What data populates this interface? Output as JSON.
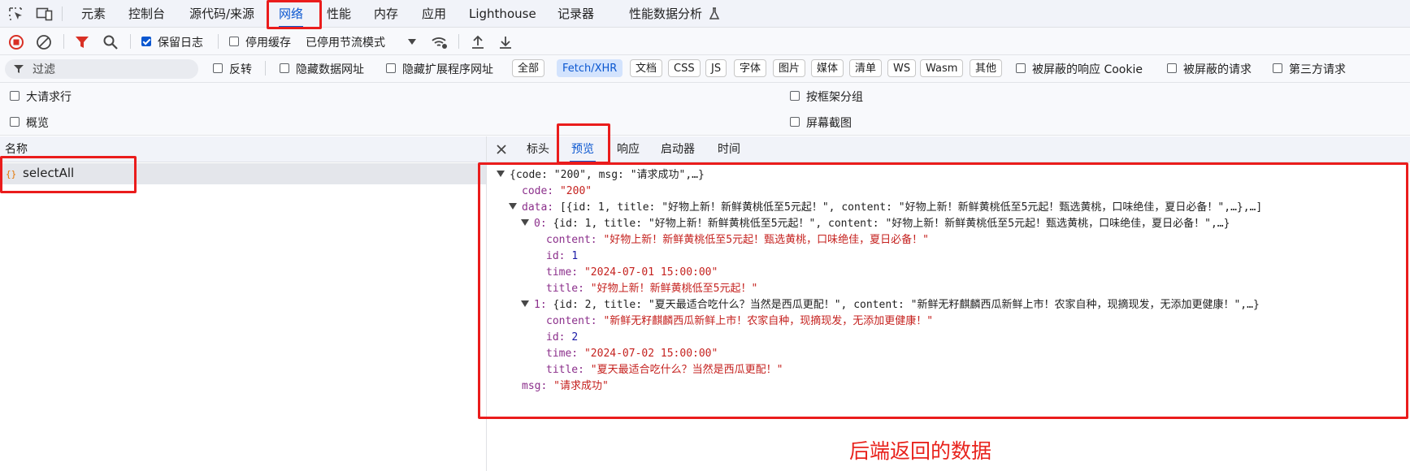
{
  "top_tabs": {
    "items": [
      "元素",
      "控制台",
      "源代码/来源",
      "网络",
      "性能",
      "内存",
      "应用",
      "Lighthouse",
      "记录器",
      "性能数据分析"
    ],
    "active": "网络"
  },
  "toolbar": {
    "preserve_log_label": "保留日志",
    "preserve_log_checked": true,
    "disable_cache_label": "停用缓存",
    "disable_cache_checked": false,
    "throttling_value": "已停用节流模式"
  },
  "filter": {
    "placeholder": "过滤",
    "invert_label": "反转",
    "hide_data_urls_label": "隐藏数据网址",
    "hide_ext_urls_label": "隐藏扩展程序网址",
    "types": [
      "全部",
      "Fetch/XHR",
      "文档",
      "CSS",
      "JS",
      "字体",
      "图片",
      "媒体",
      "清单",
      "WS",
      "Wasm",
      "其他"
    ],
    "active_type": "Fetch/XHR",
    "blocked_cookies_label": "被屏蔽的响应 Cookie",
    "blocked_requests_label": "被屏蔽的请求",
    "third_party_label": "第三方请求"
  },
  "options": {
    "big_rows": "大请求行",
    "group_by_frame": "按框架分组",
    "overview": "概览",
    "screenshots": "屏幕截图"
  },
  "requests": {
    "column_name": "名称",
    "items": [
      {
        "name": "selectAll",
        "icon": "xhr-braces-icon"
      }
    ]
  },
  "detail": {
    "tabs": [
      "标头",
      "预览",
      "响应",
      "启动器",
      "时间"
    ],
    "active_tab": "预览"
  },
  "preview": {
    "root_summary": "{code: \"200\", msg: \"请求成功\",…}",
    "code_key": "code:",
    "code_val": "\"200\"",
    "data_key": "data:",
    "data_summary": "[{id: 1, title: \"好物上新！新鲜黄桃低至5元起！\", content: \"好物上新！新鲜黄桃低至5元起！甄选黄桃，口味绝佳，夏日必备！\",…},…]",
    "item0_key": "0:",
    "item0_summary": "{id: 1, title: \"好物上新！新鲜黄桃低至5元起！\", content: \"好物上新！新鲜黄桃低至5元起！甄选黄桃，口味绝佳，夏日必备！\",…}",
    "item0_content": "\"好物上新！新鲜黄桃低至5元起！甄选黄桃，口味绝佳，夏日必备！\"",
    "item0_id": "1",
    "item0_time": "\"2024-07-01 15:00:00\"",
    "item0_title": "\"好物上新！新鲜黄桃低至5元起！\"",
    "item1_key": "1:",
    "item1_summary": "{id: 2, title: \"夏天最适合吃什么？当然是西瓜更配！\", content: \"新鲜无籽麒麟西瓜新鲜上市！农家自种，现摘现发，无添加更健康！\",…}",
    "item1_content": "\"新鲜无籽麒麟西瓜新鲜上市！农家自种，现摘现发，无添加更健康！\"",
    "item1_id": "2",
    "item1_time": "\"2024-07-02 15:00:00\"",
    "item1_title": "\"夏天最适合吃什么？当然是西瓜更配！\"",
    "content_key": "content:",
    "id_key": "id:",
    "time_key": "time:",
    "title_key": "title:",
    "msg_key": "msg:",
    "msg_val": "\"请求成功\""
  },
  "annotation": {
    "text": "后端返回的数据",
    "color": "#e8231d"
  }
}
